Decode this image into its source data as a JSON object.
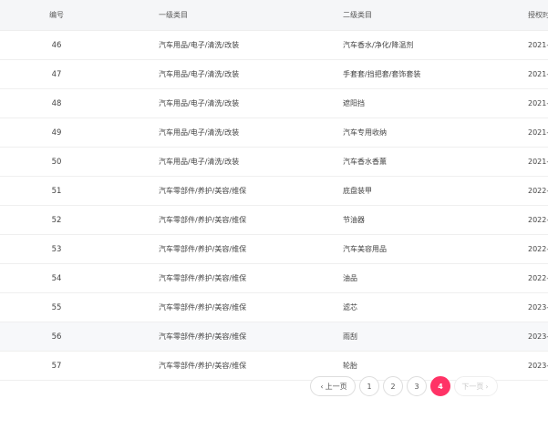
{
  "table": {
    "headers": {
      "no": "编号",
      "level1": "一级类目",
      "level2": "二级类目",
      "date": "授权时"
    },
    "rows": [
      {
        "no": "46",
        "level1": "汽车用品/电子/清洗/改装",
        "level2": "汽车香水/净化/降温剂",
        "date": "2021-"
      },
      {
        "no": "47",
        "level1": "汽车用品/电子/清洗/改装",
        "level2": "手套套/挡把套/套饰套装",
        "date": "2021-"
      },
      {
        "no": "48",
        "level1": "汽车用品/电子/清洗/改装",
        "level2": "遮阳挡",
        "date": "2021-"
      },
      {
        "no": "49",
        "level1": "汽车用品/电子/清洗/改装",
        "level2": "汽车专用收纳",
        "date": "2021-"
      },
      {
        "no": "50",
        "level1": "汽车用品/电子/清洗/改装",
        "level2": "汽车香水香薰",
        "date": "2021-"
      },
      {
        "no": "51",
        "level1": "汽车零部件/养护/美容/维保",
        "level2": "底盘装甲",
        "date": "2022-"
      },
      {
        "no": "52",
        "level1": "汽车零部件/养护/美容/维保",
        "level2": "节油器",
        "date": "2022-"
      },
      {
        "no": "53",
        "level1": "汽车零部件/养护/美容/维保",
        "level2": "汽车美容用品",
        "date": "2022-"
      },
      {
        "no": "54",
        "level1": "汽车零部件/养护/美容/维保",
        "level2": "油品",
        "date": "2022-"
      },
      {
        "no": "55",
        "level1": "汽车零部件/养护/美容/维保",
        "level2": "滤芯",
        "date": "2023-"
      },
      {
        "no": "56",
        "level1": "汽车零部件/养护/美容/维保",
        "level2": "雨刮",
        "date": "2023-"
      },
      {
        "no": "57",
        "level1": "汽车零部件/养护/美容/维保",
        "level2": "轮胎",
        "date": "2023-"
      }
    ]
  },
  "pagination": {
    "prev_label": "上一页",
    "next_label": "下一页",
    "prev_arrow": "‹",
    "next_arrow": "›",
    "pages": [
      "1",
      "2",
      "3",
      "4"
    ],
    "current_page": "4"
  },
  "colors": {
    "accent": "#ff3366",
    "header_bg": "#f5f6f8",
    "highlight_row_bg": "#f7f8fa"
  }
}
